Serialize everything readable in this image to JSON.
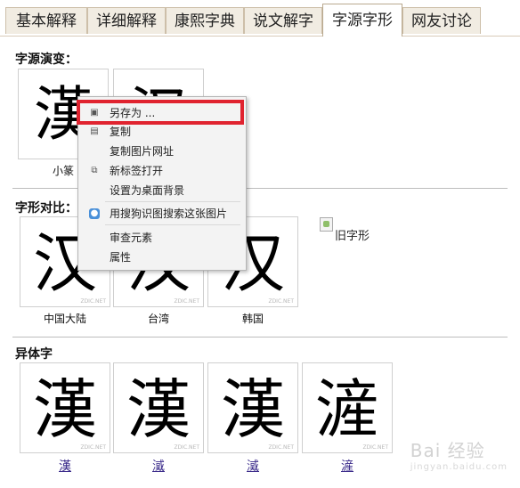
{
  "tabs": [
    "基本解释",
    "详细解释",
    "康熙字典",
    "说文解字",
    "字源字形",
    "网友讨论"
  ],
  "active_tab": "字源字形",
  "sections": {
    "evolution": {
      "title": "字源演变：",
      "items": [
        {
          "glyph": "漢",
          "caption": "小篆"
        },
        {
          "glyph": "汉",
          "caption": ""
        }
      ]
    },
    "compare": {
      "title": "字形对比：",
      "items": [
        {
          "glyph": "汉",
          "caption": "中国大陆"
        },
        {
          "glyph": "汉",
          "caption": "台湾"
        },
        {
          "glyph": "汉",
          "caption": "韩国"
        }
      ],
      "old_glyph_label": "旧字形"
    },
    "variants": {
      "title": "异体字",
      "items": [
        {
          "glyph": "漢",
          "link": "漢"
        },
        {
          "glyph": "漢",
          "link": "㵄"
        },
        {
          "glyph": "漢",
          "link": "㵄"
        },
        {
          "glyph": "滻",
          "link": "滻"
        }
      ]
    }
  },
  "watermark_site": "ZDIC.NET",
  "context_menu": {
    "items": [
      {
        "label": "另存为 ...",
        "icon": "save-icon"
      },
      {
        "label": "复制",
        "icon": "copy-icon"
      },
      {
        "label": "复制图片网址",
        "icon": ""
      },
      {
        "label": "新标签打开",
        "icon": "new-tab-icon"
      },
      {
        "label": "设置为桌面背景",
        "icon": ""
      },
      {
        "label": "用搜狗识图搜索这张图片",
        "icon": "sogou-search-icon"
      },
      {
        "label": "审查元素",
        "icon": ""
      },
      {
        "label": "属性",
        "icon": ""
      }
    ]
  },
  "page_watermark": {
    "main": "Bai 经验",
    "sub": "jingyan.baidu.com"
  }
}
